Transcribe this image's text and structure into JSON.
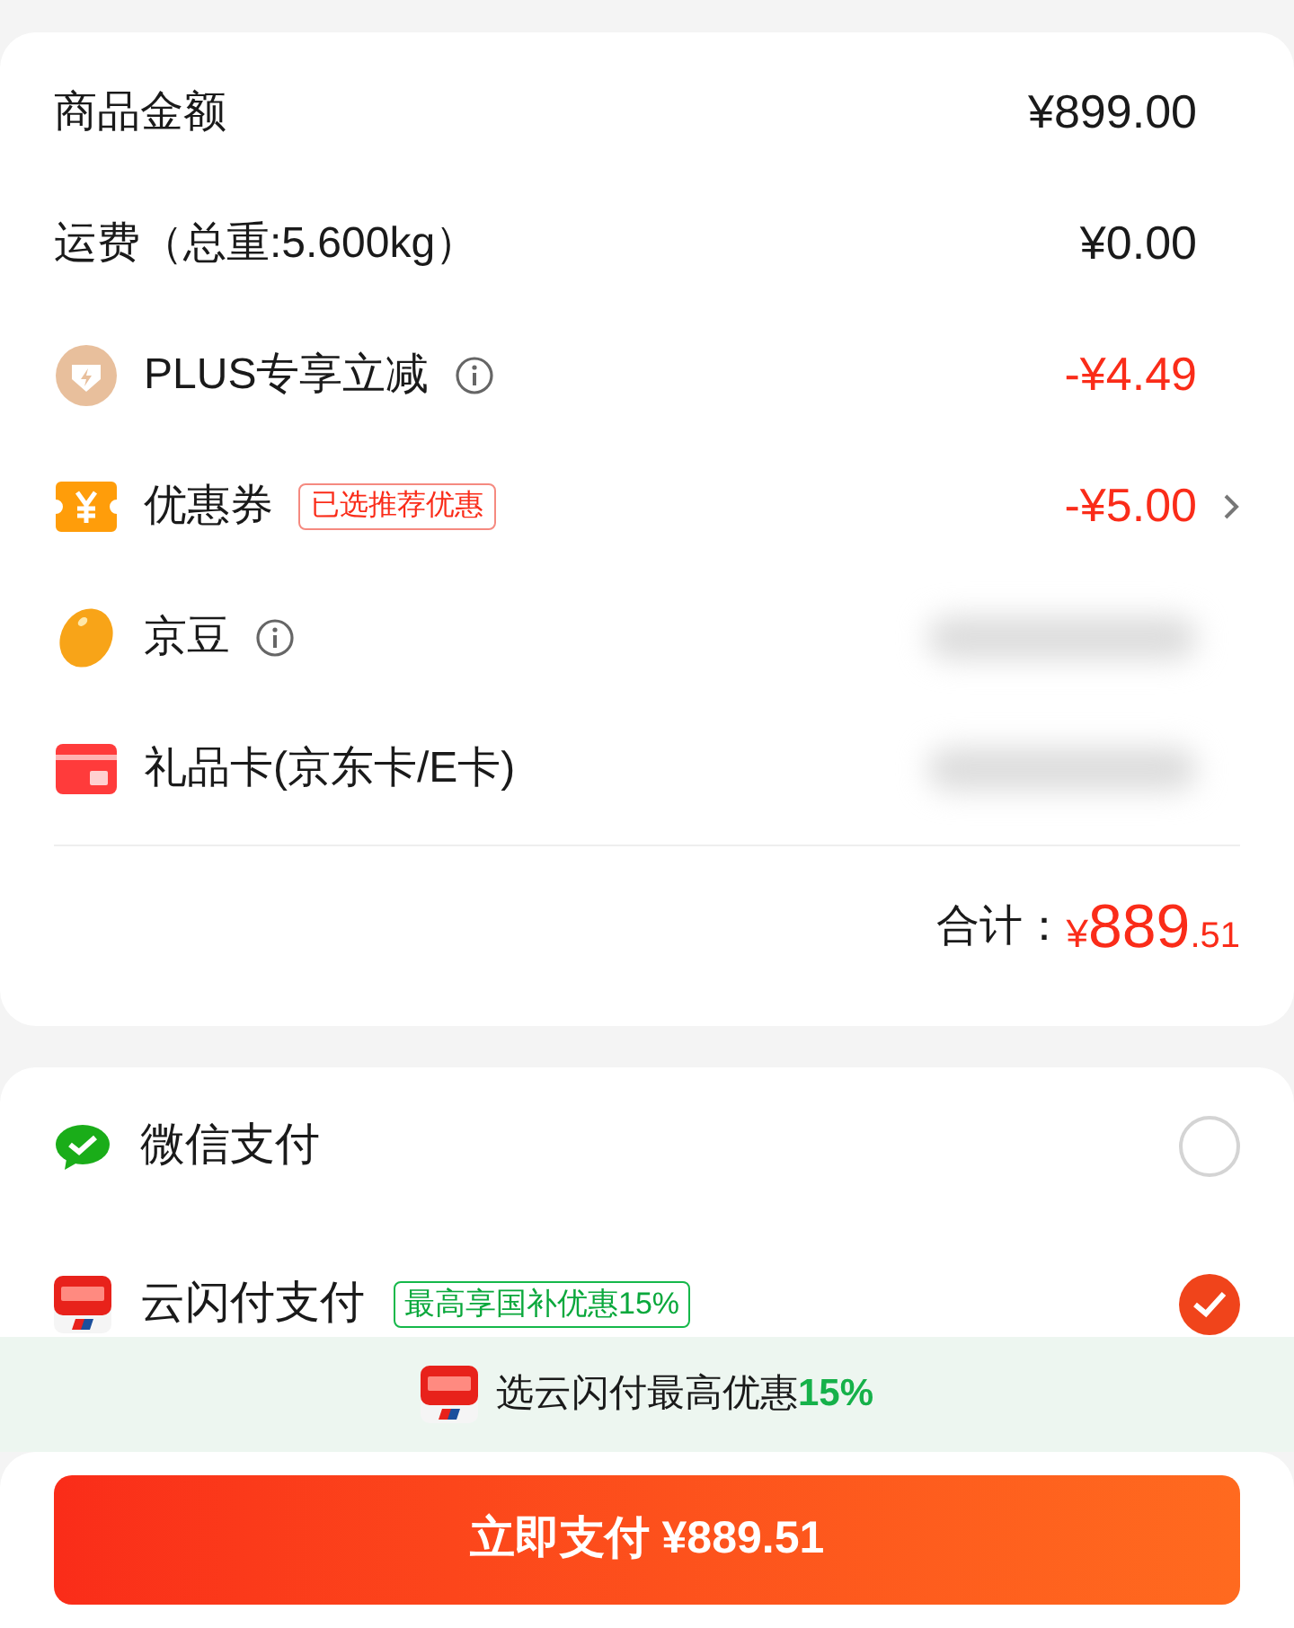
{
  "summary": {
    "rows": [
      {
        "label": "商品金额",
        "value": "¥899.00",
        "kind": "amount",
        "info": false,
        "chevron": false
      },
      {
        "label": "运费（总重:5.600kg）",
        "value": "¥0.00",
        "kind": "amount",
        "info": false,
        "chevron": false
      },
      {
        "label": "PLUS专享立减",
        "value": "-¥4.49",
        "kind": "discount",
        "info": true,
        "chevron": false
      },
      {
        "label": "优惠券",
        "tag": "已选推荐优惠",
        "value": "-¥5.00",
        "kind": "discount",
        "info": false,
        "chevron": true
      },
      {
        "label": "京豆",
        "kind": "redacted",
        "info": true,
        "chevron": false
      },
      {
        "label": "礼品卡(京东卡/E卡)",
        "kind": "redacted",
        "info": false,
        "chevron": false
      }
    ],
    "total": {
      "label": "合计：",
      "currency": "¥",
      "integer": "889",
      "decimal": ".51"
    }
  },
  "payment_methods": [
    {
      "name": "微信支付",
      "selected": false
    },
    {
      "name": "云闪付支付",
      "tag": "最高享国补优惠15%",
      "selected": true
    }
  ],
  "promo_banner": {
    "text": "选云闪付最高优惠",
    "highlight": "15%"
  },
  "pay_button": {
    "label": "立即支付 ¥889.51"
  }
}
